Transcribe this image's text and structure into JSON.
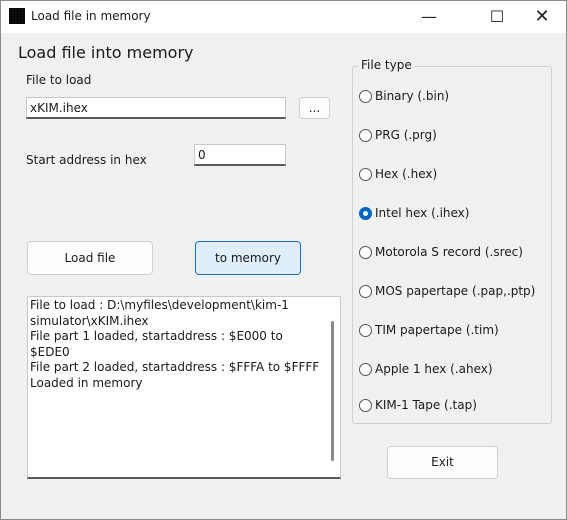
{
  "window": {
    "title": "Load file in memory"
  },
  "heading": "Load file into memory",
  "file": {
    "label": "File to load",
    "value": "xKIM.ihex",
    "browse_label": "..."
  },
  "start": {
    "label": "Start address in hex",
    "value": "0"
  },
  "buttons": {
    "load": "Load file",
    "to_memory": "to memory",
    "exit": "Exit"
  },
  "log": {
    "text": "File to load : D:\\myfiles\\development\\kim-1 simulator\\xKIM.ihex\nFile part 1 loaded, startaddress : $E000 to $EDE0\nFile part 2 loaded, startaddress : $FFFA to $FFFF\nLoaded in memory"
  },
  "file_type": {
    "title": "File type",
    "options": [
      {
        "label": "Binary (.bin)",
        "checked": false
      },
      {
        "label": "PRG (.prg)",
        "checked": false
      },
      {
        "label": "Hex (.hex)",
        "checked": false
      },
      {
        "label": "Intel hex (.ihex)",
        "checked": true
      },
      {
        "label": "Motorola S record (.srec)",
        "checked": false
      },
      {
        "label": "MOS papertape (.pap,.ptp)",
        "checked": false
      },
      {
        "label": "TIM papertape (.tim)",
        "checked": false
      },
      {
        "label": "Apple 1 hex (.ahex)",
        "checked": false
      },
      {
        "label": "KIM-1 Tape (.tap)",
        "checked": false
      }
    ]
  }
}
